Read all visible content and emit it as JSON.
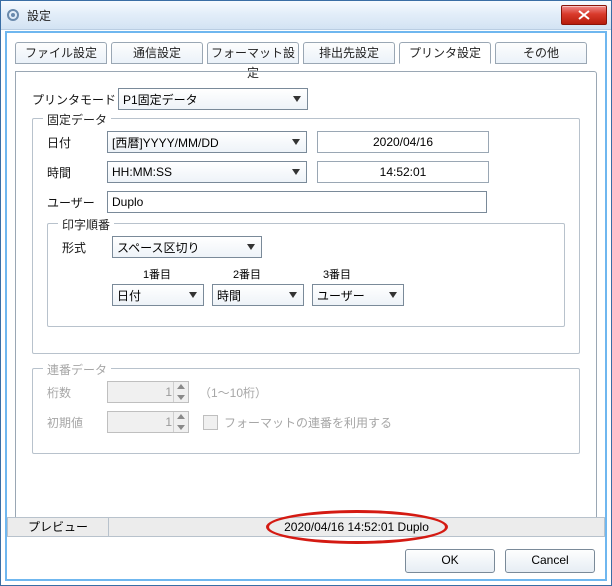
{
  "window": {
    "title": "設定"
  },
  "tabs": {
    "file": "ファイル設定",
    "comm": "通信設定",
    "format": "フォーマット設定",
    "dest": "排出先設定",
    "printer": "プリンタ設定",
    "other": "その他"
  },
  "printer_mode": {
    "label": "プリンタモード",
    "value": "P1固定データ"
  },
  "fixed": {
    "legend": "固定データ",
    "date": {
      "label": "日付",
      "format": "[西暦]YYYY/MM/DD",
      "value": "2020/04/16"
    },
    "time": {
      "label": "時間",
      "format": "HH:MM:SS",
      "value": "14:52:01"
    },
    "user": {
      "label": "ユーザー",
      "value": "Duplo"
    }
  },
  "order": {
    "legend": "印字順番",
    "style": {
      "label": "形式",
      "value": "スペース区切り"
    },
    "cols": {
      "c1": "1番目",
      "c2": "2番目",
      "c3": "3番目"
    },
    "v1": "日付",
    "v2": "時間",
    "v3": "ユーザー"
  },
  "serial": {
    "legend": "連番データ",
    "digits": {
      "label": "桁数",
      "value": "1",
      "hint": "（1～10桁）"
    },
    "init": {
      "label": "初期値",
      "value": "1"
    },
    "usefmt": "フォーマットの連番を利用する"
  },
  "preview": {
    "label": "プレビュー",
    "value": "2020/04/16 14:52:01 Duplo"
  },
  "buttons": {
    "ok": "OK",
    "cancel": "Cancel"
  }
}
